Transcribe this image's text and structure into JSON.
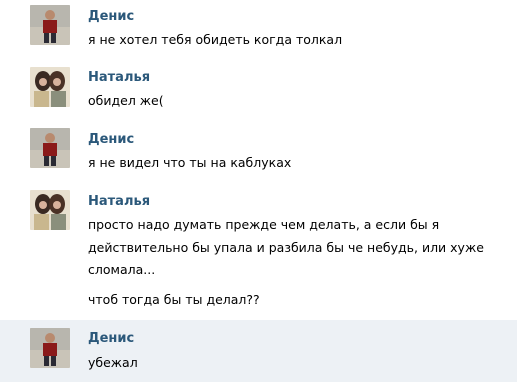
{
  "messages": [
    {
      "author": "Денис",
      "avatar": "denis-avatar",
      "lines": [
        "я не хотел тебя обидеть когда толкал"
      ]
    },
    {
      "author": "Наталья",
      "avatar": "natalya-avatar",
      "lines": [
        "обидел же("
      ]
    },
    {
      "author": "Денис",
      "avatar": "denis-avatar",
      "lines": [
        "я не видел что ты на каблуках"
      ]
    },
    {
      "author": "Наталья",
      "avatar": "natalya-avatar",
      "lines": [
        "просто надо думать прежде чем делать, а если бы я",
        "действительно бы упала и разбила бы че небудь, или хуже",
        "сломала...",
        "чтоб тогда бы ты делал??"
      ]
    },
    {
      "author": "Денис",
      "avatar": "denis-avatar",
      "lines": [
        "убежал"
      ],
      "highlighted": true
    }
  ],
  "colors": {
    "author_link": "#2b587a",
    "highlight_bg": "#edf1f5"
  }
}
